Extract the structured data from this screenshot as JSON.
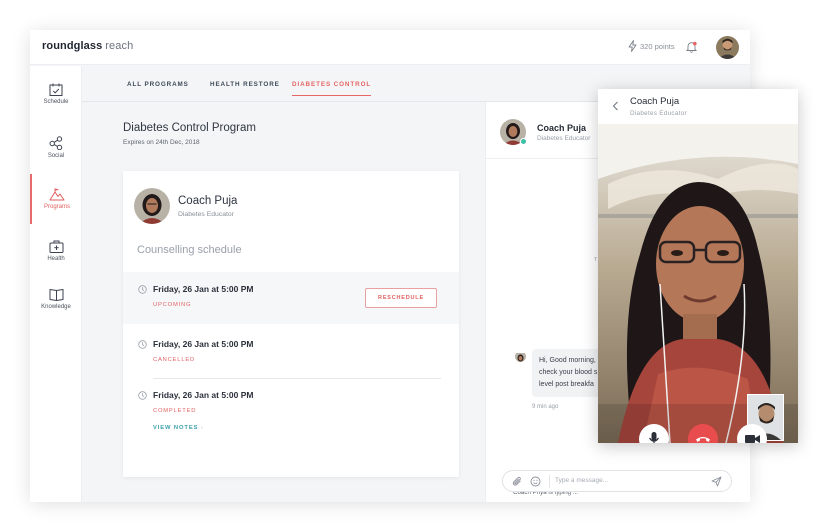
{
  "header": {
    "brand_bold": "roundglass",
    "brand_light": "reach",
    "points": "320 points"
  },
  "sidebar": {
    "items": [
      {
        "label": "Schedule",
        "icon": "calendar-icon",
        "active": false
      },
      {
        "label": "Social",
        "icon": "share-icon",
        "active": false
      },
      {
        "label": "Programs",
        "icon": "mountain-icon",
        "active": true
      },
      {
        "label": "Health",
        "icon": "medical-kit-icon",
        "active": false
      },
      {
        "label": "Knowledge",
        "icon": "book-icon",
        "active": false
      }
    ]
  },
  "tabs": [
    {
      "label": "ALL PROGRAMS",
      "active": false
    },
    {
      "label": "HEALTH RESTORE",
      "active": false
    },
    {
      "label": "DIABETES CONTROL",
      "active": true
    }
  ],
  "program": {
    "title": "Diabetes Control Program",
    "expires": "Expires on 24th Dec, 2018"
  },
  "coach": {
    "name": "Coach Puja",
    "role": "Diabetes Educator"
  },
  "schedule": {
    "title": "Counselling schedule",
    "reschedule_label": "RESCHEDULE",
    "view_notes_label": "VIEW NOTES",
    "sessions": [
      {
        "when": "Friday, 26 Jan at 5:00 PM",
        "status": "UPCOMING"
      },
      {
        "when": "Friday, 26 Jan at 5:00 PM",
        "status": "CANCELLED"
      },
      {
        "when": "Friday, 26 Jan at 5:00 PM",
        "status": "COMPLETED"
      }
    ]
  },
  "chat": {
    "name": "Coach Puja",
    "role": "Diabetes Educator",
    "day_marker": "T",
    "message_lines": [
      "Hi, Good morning,",
      "check your blood s",
      "level post breakfa"
    ],
    "message_time": "9 min ago",
    "typing": "Coach Priya is typing ...",
    "input_placeholder": "Type a message..."
  },
  "video": {
    "name": "Coach Puja",
    "role": "Diabetes Educator"
  },
  "colors": {
    "accent": "#e66565",
    "teal": "#3aa0a8",
    "online": "#3cc0a6",
    "end_call": "#e84c4c"
  }
}
